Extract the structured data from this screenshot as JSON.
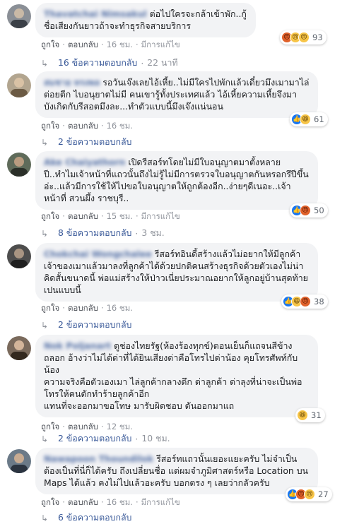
{
  "labels": {
    "like": "ถูกใจ",
    "reply": "ตอบกลับ",
    "edited": "มีการแก้ไข",
    "sep": "·"
  },
  "comments": [
    {
      "author": "Thavatchai Nimsakul",
      "text": "ต่อไปใครจะกล้าเข้าพัก..กู้ชื่อเสียงกันยาวถ้าจะทำธุรกิจสายบริการ",
      "reactions": [
        "angry",
        "sad",
        "sad"
      ],
      "count": "93",
      "time": "16 ชม.",
      "edited": true,
      "replies_label": "16 ข้อความตอบกลับ",
      "replies_time": "22 นาที"
    },
    {
      "author": "สมชาย ทรงพล",
      "text": "รอวันเจ๊งเลยไอ้เหี้ย..ไม่มีใครไปพักแล้วเดี๋ยวมึงเมามาไล่ต่อยตีก ไบอนุยาตไม่มี คนเขารู้ทั้งประเทศแล้ว ไอ้เหี้ยความเหี้ยจึงมาบังเกิดกับรีสอตมึงละ...ทำตัวแบบนี้มึงเจ๊งแน่นอน",
      "reactions": [
        "like",
        "haha"
      ],
      "count": "61",
      "time": "16 ชม.",
      "edited": false,
      "replies_label": "2 ข้อความตอบกลับ",
      "replies_time": ""
    },
    {
      "author": "Ake Chaiyathorn",
      "text": "เปิดรีสอร์ทโดยไม่มีใบอนุญาตมาตั้งหลายปี..ทำไมเจ้าหน้าที่แถวนั้นถึงไม่รู้ไม่มีการตรวจใบอนุญาตกันหรอกรึปีขึ้นอ่ะ..แล้วมีการใช้ให้ไปขอใบอนุญาตให้ถูกต้องอีก..ง่ายๆดีเนอะ..เจ้าหน้าที่ สวนผึ้ง ราชบุรี..",
      "reactions": [
        "like",
        "angry"
      ],
      "count": "50",
      "time": "15 ชม.",
      "edited": true,
      "replies_label": "8 ข้อความตอบกลับ",
      "replies_time": "3 ชม."
    },
    {
      "author": "Chokchai Wongchalee",
      "text": "รีสอร์ทอินดี้สร้างแล้วไม่อยากให้มีลูกค้าเจ้าของเมาแล้วมาลงที่ลูกค้าได้ด้วยปกติคนสร้างธุรกิจด้วยตัวเองไม่น่าคิดสั้นขนาดนี้ พ่อแม่สร้างให้ป่าวเนี่ยประมาณอยากให้ลูกอยู่บ้านสุดท้ายเปนแบบนี้",
      "reactions": [
        "like",
        "haha",
        "angry"
      ],
      "count": "38",
      "time": "16 ชม.",
      "edited": false,
      "replies_label": "2 ข้อความตอบกลับ",
      "replies_time": ""
    },
    {
      "author": "Nok Poljanart",
      "text": "ดูช่องไทยรัฐ(ห้องร้องทุกข์)ตอนเย็นก็แถจนสีข้างถลอก อ้างว่าไม่ได้ด่าที่ได้ยินเสียงด่าคือโทรไปด่าน้อง คุยโทรศัพท์กับน้อง\nความจริงคือตัวเองเมา ไล่ลูกค้ากลางดึก ด่าลูกค้า ด่าลุงที่น่าจะเป็นพ่อ โทรให้คนดักทำร้ายลูกค้าอีก\nแทนที่จะออกมาขอโทษ มารับผิดชอบ ดันออกมาแถ",
      "reactions": [
        "haha"
      ],
      "count": "31",
      "time": "12 ชม.",
      "edited": false,
      "replies_label": "2 ข้อความตอบกลับ",
      "replies_time": "10 ชม."
    },
    {
      "author": "Nawapoon Thoundilok",
      "text": "รีสอร์ทแถวนั้นเยอะแยะครับ ไม่จำเป็นต้องเป็นที่นี่ก็ได้ครับ ถึงเปลี่ยนชื่อ แต่ผมจำภูมิศาสตร์หรือ Location บน Maps ได้แล้ว คงไม่ไปแล้วอะครับ บอกตรง ๆ เลยว่ากลัวครับ",
      "reactions": [
        "like",
        "angry",
        "sad"
      ],
      "count": "27",
      "time": "16 ชม.",
      "edited": true,
      "replies_label": "6 ข้อความตอบกลับ",
      "replies_time": ""
    }
  ]
}
